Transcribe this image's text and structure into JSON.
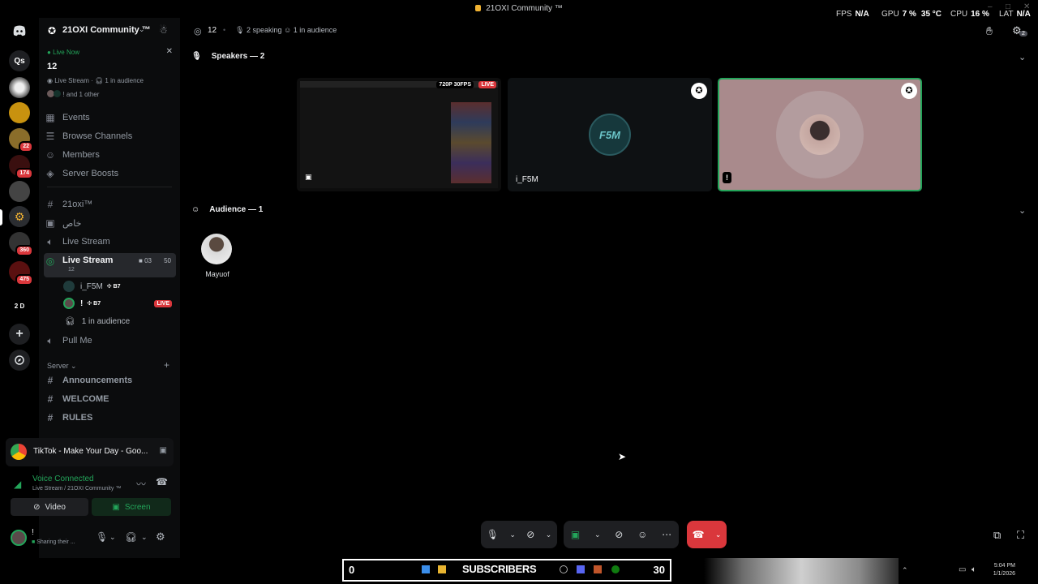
{
  "window": {
    "title": "21OXI Community ™",
    "overlay": {
      "fps_label": "FPS",
      "fps_value": "N/A",
      "gpu_label": "GPU",
      "gpu_value": "7 %",
      "gpu_temp": "35 °C",
      "cpu_label": "CPU",
      "cpu_value": "16 %",
      "lat_label": "LAT",
      "lat_value": "N/A"
    }
  },
  "rail": {
    "servers": [
      {
        "label": "Qs"
      },
      {
        "badge": "22"
      },
      {
        "badge": "174"
      },
      {
        "badge": "360"
      },
      {
        "badge": "475"
      },
      {
        "label": "2 D"
      }
    ]
  },
  "server": {
    "name": "21OXI Community ™",
    "live": {
      "status": "Live Now",
      "count": "12",
      "info": "Live Stream",
      "audience": "1 in audience",
      "others": "! and 1 other"
    },
    "menu": [
      {
        "label": "Events",
        "icon": "calendar-icon"
      },
      {
        "label": "Browse Channels",
        "icon": "list-icon"
      },
      {
        "label": "Members",
        "icon": "members-icon"
      },
      {
        "label": "Server Boosts",
        "icon": "boost-icon"
      }
    ],
    "channels": [
      {
        "label": "21oxi™",
        "icon": "hash-icon"
      },
      {
        "label": "خاص",
        "icon": "text-channel-icon"
      },
      {
        "label": "Live Stream",
        "icon": "speaker-icon"
      }
    ],
    "active_channel": {
      "label": "Live Stream",
      "sub": "12",
      "video_count": "03",
      "user_limit": "50"
    },
    "voice_users": [
      {
        "name": "i_F5M",
        "tag": "B7"
      },
      {
        "name": "!",
        "tag": "B7",
        "live": "LIVE"
      }
    ],
    "audience_label": "1 in audience",
    "pull_me": "Pull Me",
    "category": "Server",
    "text_channels": [
      "Announcements",
      "WELCOME",
      "RULES"
    ]
  },
  "activity": {
    "title": "TikTok - Make Your Day - Goo..."
  },
  "voice": {
    "status": "Voice Connected",
    "channel": "Live Stream / 21OXI Community ™",
    "video_label": "Video",
    "screen_label": "Screen"
  },
  "user": {
    "name": "!",
    "status": "Sharing their ..."
  },
  "stage": {
    "participants": "12",
    "speaking": "2 speaking",
    "audience": "1 in audience",
    "speakers_header": "Speakers — 2",
    "audience_header": "Audience — 1",
    "stream_quality": "720P 30FPS",
    "stream_live": "LIVE",
    "speaker_names": [
      "",
      "i_F5M",
      "!"
    ],
    "speaker2_logo": "F5M",
    "audience_members": [
      "Mayuof"
    ],
    "notif_count": "2"
  },
  "taskbar": {
    "left_count": "0",
    "label": "SUBSCRIBERS",
    "right_count": "30",
    "time": "5:04 PM",
    "date": "1/1/2026"
  },
  "colors": {
    "accent_green": "#23a55a",
    "danger_red": "#da373c",
    "brand": "#5865f2"
  }
}
